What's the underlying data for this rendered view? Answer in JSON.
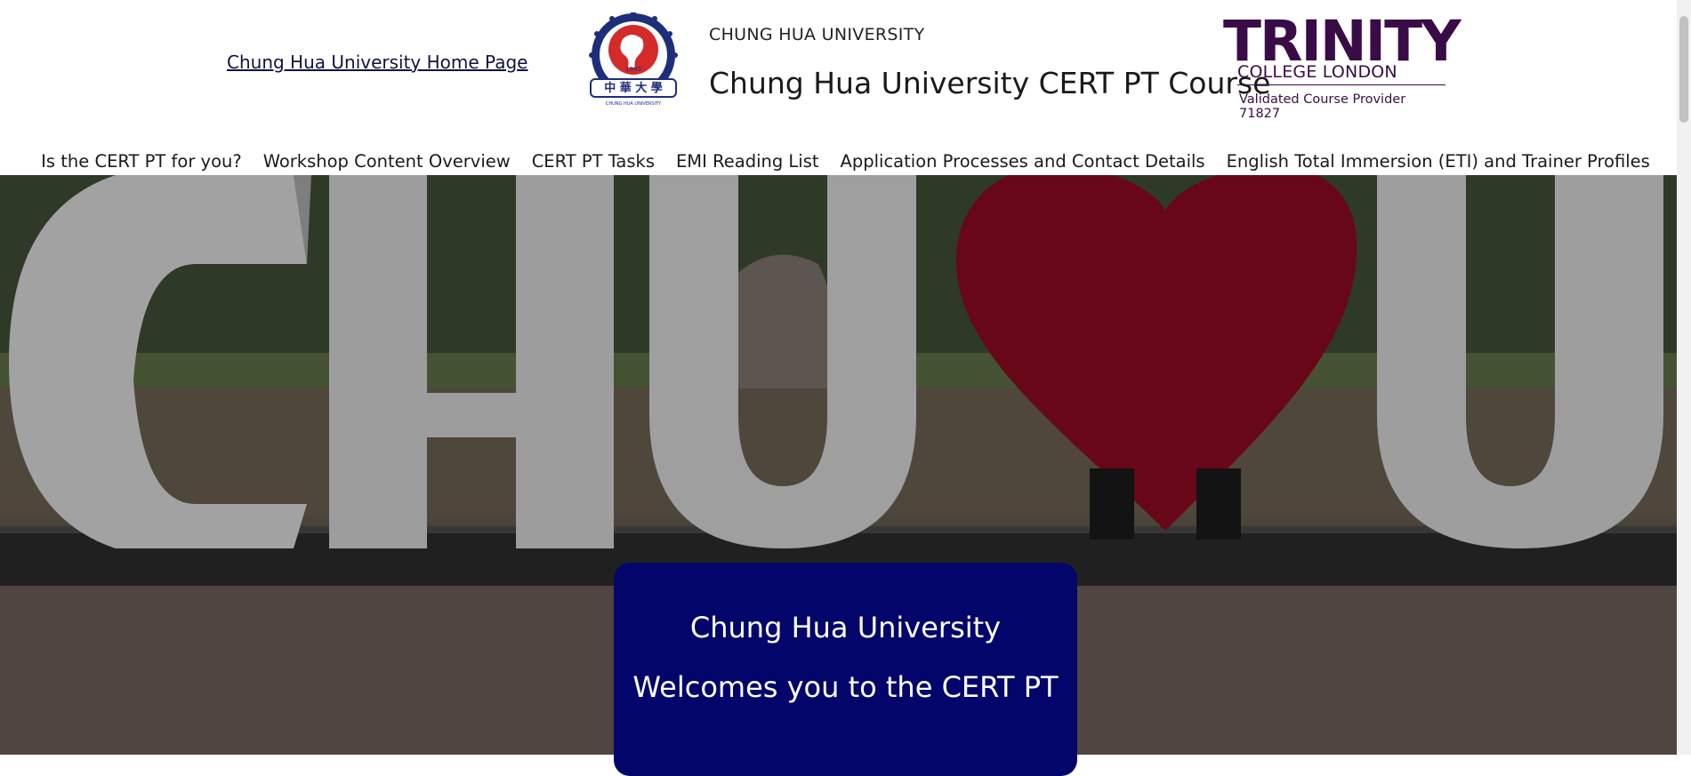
{
  "header": {
    "home_link": "Chung Hua University Home Page",
    "university_small": "CHUNG HUA UNIVERSITY",
    "site_title": "Chung Hua University CERT PT Course",
    "seal": {
      "year": "1990",
      "chinese": "中 華 大 學",
      "english": "CHUNG HUA UNIVERSITY"
    },
    "trinity": {
      "word": "TRINITY",
      "sub": "COLLEGE LONDON",
      "provider": "Validated Course Provider 71827",
      "color": "#3a0c47"
    }
  },
  "nav": {
    "items": [
      "Is the CERT PT for you?",
      "Workshop Content Overview",
      "CERT PT Tasks",
      "EMI Reading List",
      "Application Processes and Contact Details",
      "English Total Immersion (ETI) and Trainer Profiles"
    ]
  },
  "hero": {
    "card": {
      "line1": "Chung Hua University",
      "line2": "Welcomes you to the CERT PT",
      "color": "#04056b"
    },
    "heart_color": "#8a0a1f"
  }
}
